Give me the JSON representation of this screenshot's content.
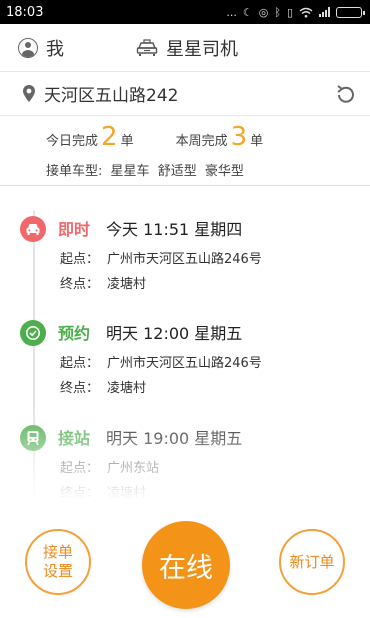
{
  "status_bar": {
    "time": "18:03",
    "icons": [
      "more-icon",
      "moon-icon",
      "alarm-icon",
      "bluetooth-icon",
      "vibrate-icon",
      "wifi-icon",
      "signal-icon",
      "battery-icon"
    ],
    "more": "..."
  },
  "header": {
    "me_label": "我",
    "app_title": "星星司机"
  },
  "address": {
    "text": "天河区五山路242"
  },
  "stats": {
    "today_prefix": "今日完成",
    "today_count": "2",
    "today_suffix": "单",
    "week_prefix": "本周完成",
    "week_count": "3",
    "week_suffix": "单",
    "car_types_label": "接单车型:",
    "car_types": [
      "星星车",
      "舒适型",
      "豪华型"
    ]
  },
  "orders": [
    {
      "type": "即时",
      "color": "#f0686a",
      "icon": "car-icon",
      "time": "今天 11:51 星期四",
      "start_label": "起点：",
      "start": "广州市天河区五山路246号",
      "end_label": "终点：",
      "end": "凌塘村"
    },
    {
      "type": "预约",
      "color": "#4cae4c",
      "icon": "clock-icon",
      "time": "明天 12:00 星期五",
      "start_label": "起点：",
      "start": "广州市天河区五山路246号",
      "end_label": "终点：",
      "end": "凌塘村"
    },
    {
      "type": "接站",
      "color": "#4cae4c",
      "icon": "train-icon",
      "time": "明天 19:00 星期五",
      "start_label": "起点：",
      "start": "广州东站",
      "end_label": "终点：",
      "end": "凌塘村"
    }
  ],
  "bottom": {
    "settings_line1": "接单",
    "settings_line2": "设置",
    "online": "在线",
    "new_order": "新订单",
    "accent": "#f39419"
  }
}
